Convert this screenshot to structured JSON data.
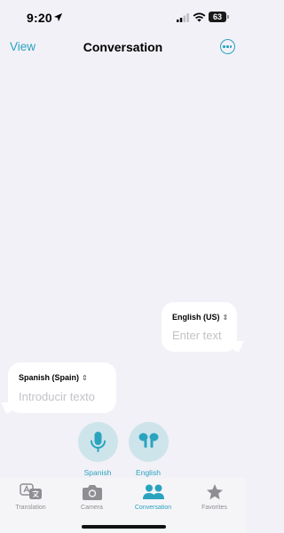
{
  "status": {
    "time": "9:20",
    "battery": "63"
  },
  "nav": {
    "left": "View",
    "title": "Conversation"
  },
  "bubbles": {
    "english": {
      "language": "English (US)",
      "placeholder": "Enter text"
    },
    "spanish": {
      "language": "Spanish (Spain)",
      "placeholder": "Introducir texto"
    }
  },
  "mics": {
    "spanish_label": "Spanish",
    "english_label": "English"
  },
  "tabs": [
    {
      "label": "Translation",
      "icon": "translate-icon"
    },
    {
      "label": "Camera",
      "icon": "camera-icon"
    },
    {
      "label": "Conversation",
      "icon": "people-icon"
    },
    {
      "label": "Favorites",
      "icon": "star-icon"
    }
  ],
  "colors": {
    "accent": "#2aa3bf",
    "mic_background": "#cde4eb",
    "background": "#f2f1f7"
  }
}
